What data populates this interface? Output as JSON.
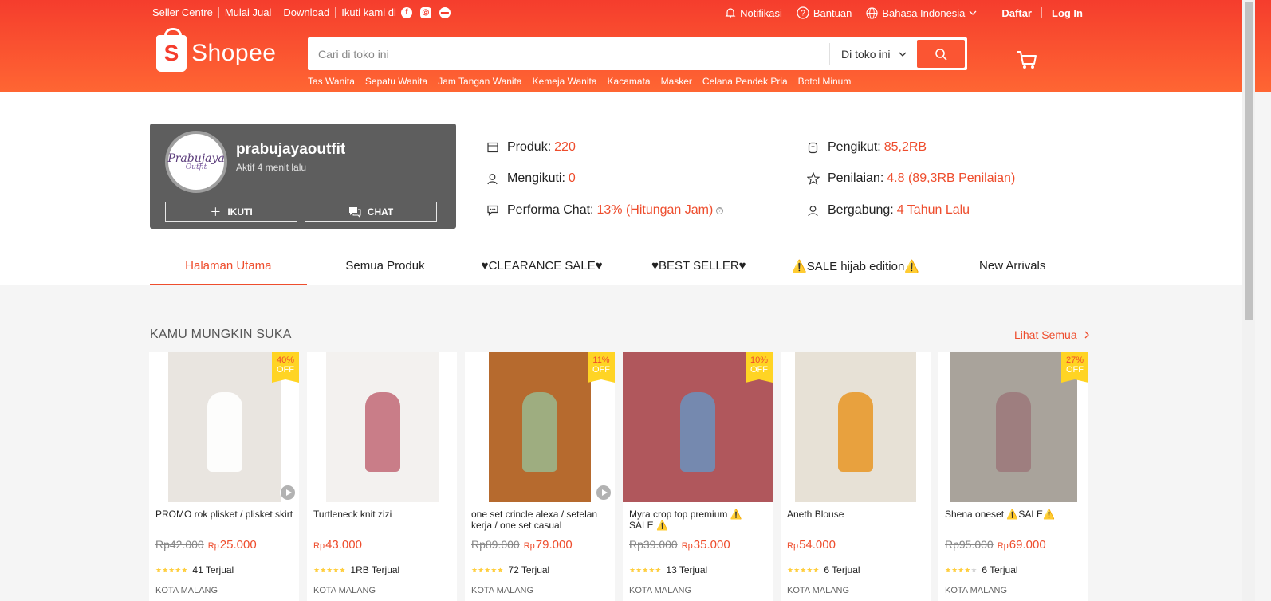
{
  "topbar": {
    "left": [
      "Seller Centre",
      "Mulai Jual",
      "Download",
      "Ikuti kami di"
    ],
    "social_icons": [
      "facebook-icon",
      "instagram-icon",
      "line-icon"
    ],
    "notif": "Notifikasi",
    "help": "Bantuan",
    "lang": "Bahasa Indonesia",
    "signup": "Daftar",
    "login": "Log In"
  },
  "logo": {
    "text": "Shopee",
    "bag": "S"
  },
  "search": {
    "placeholder": "Cari di toko ini",
    "scope": "Di toko ini",
    "suggestions": [
      "Tas Wanita",
      "Sepatu Wanita",
      "Jam Tangan Wanita",
      "Kemeja Wanita",
      "Kacamata",
      "Masker",
      "Celana Pendek Pria",
      "Botol Minum"
    ]
  },
  "shop": {
    "name": "prabujayaoutfit",
    "active": "Aktif 4 menit lalu",
    "avatar_logo": {
      "line1": "Prabujaya",
      "line2": "Outfit"
    },
    "follow_btn": "IKUTI",
    "chat_btn": "CHAT",
    "stats": [
      {
        "label": "Produk:",
        "value": "220",
        "icon": "store-icon"
      },
      {
        "label": "Pengikut:",
        "value": "85,2RB",
        "icon": "followers-icon"
      },
      {
        "label": "Mengikuti:",
        "value": "0",
        "icon": "user-plus-icon"
      },
      {
        "label": "Penilaian:",
        "value": "4.8 (89,3RB Penilaian)",
        "icon": "star-icon"
      },
      {
        "label": "Performa Chat:",
        "value": "13% (Hitungan Jam)",
        "icon": "chat-icon"
      },
      {
        "label": "Bergabung:",
        "value": "4 Tahun Lalu",
        "icon": "user-check-icon"
      }
    ]
  },
  "tabs": [
    "Halaman Utama",
    "Semua Produk",
    "♥CLEARANCE SALE♥",
    "♥BEST SELLER♥",
    "⚠️SALE hijab edition⚠️",
    "New Arrivals"
  ],
  "recommend": {
    "title": "KAMU MUNGKIN SUKA",
    "see_all": "Lihat Semua",
    "products": [
      {
        "name": "PROMO rok plisket / plisket skirt",
        "old": "Rp42.000",
        "cur": "Rp",
        "price": "25.000",
        "sold": "41 Terjual",
        "discount": "40%",
        "off": "OFF",
        "rating": 4.5,
        "loc": "KOTA MALANG",
        "img_color": "#e9e5e0",
        "img_accent": "#ffffff",
        "video": true
      },
      {
        "name": "Turtleneck knit zizi",
        "old": "",
        "cur": "Rp",
        "price": "43.000",
        "sold": "1RB Terjual",
        "discount": "",
        "off": "",
        "rating": 5,
        "loc": "KOTA MALANG",
        "img_color": "#f3f1ef",
        "img_accent": "#c4707c",
        "video": false
      },
      {
        "name": "one set crincle alexa / setelan kerja / one set casual",
        "old": "Rp89.000",
        "cur": "Rp",
        "price": "79.000",
        "sold": "72 Terjual",
        "discount": "11%",
        "off": "OFF",
        "rating": 5,
        "loc": "KOTA MALANG",
        "img_color": "#b66a2e",
        "img_accent": "#9bb58a",
        "video": true
      },
      {
        "name": "Myra crop top premium ⚠️ SALE ⚠️",
        "old": "Rp39.000",
        "cur": "Rp",
        "price": "35.000",
        "sold": "13 Terjual",
        "discount": "10%",
        "off": "OFF",
        "rating": 5,
        "loc": "KOTA MALANG",
        "img_color": "#b0575c",
        "img_accent": "#6f8fb8",
        "video": false
      },
      {
        "name": "Aneth Blouse",
        "old": "",
        "cur": "Rp",
        "price": "54.000",
        "sold": "6 Terjual",
        "discount": "",
        "off": "",
        "rating": 5,
        "loc": "KOTA MALANG",
        "img_color": "#e7e1d6",
        "img_accent": "#e89a2e",
        "video": false
      },
      {
        "name": "Shena oneset ⚠️SALE⚠️",
        "old": "Rp95.000",
        "cur": "Rp",
        "price": "69.000",
        "sold": "6 Terjual",
        "discount": "27%",
        "off": "OFF",
        "rating": 4,
        "loc": "KOTA MALANG",
        "img_color": "#a9a39b",
        "img_accent": "#9c7a7c",
        "video": false
      }
    ]
  },
  "colors": {
    "brand": "#ee4d2d",
    "header_top": "#f53d2d",
    "header_bottom": "#ff6633",
    "badge": "#ffd424",
    "star": "#ffce3d"
  }
}
